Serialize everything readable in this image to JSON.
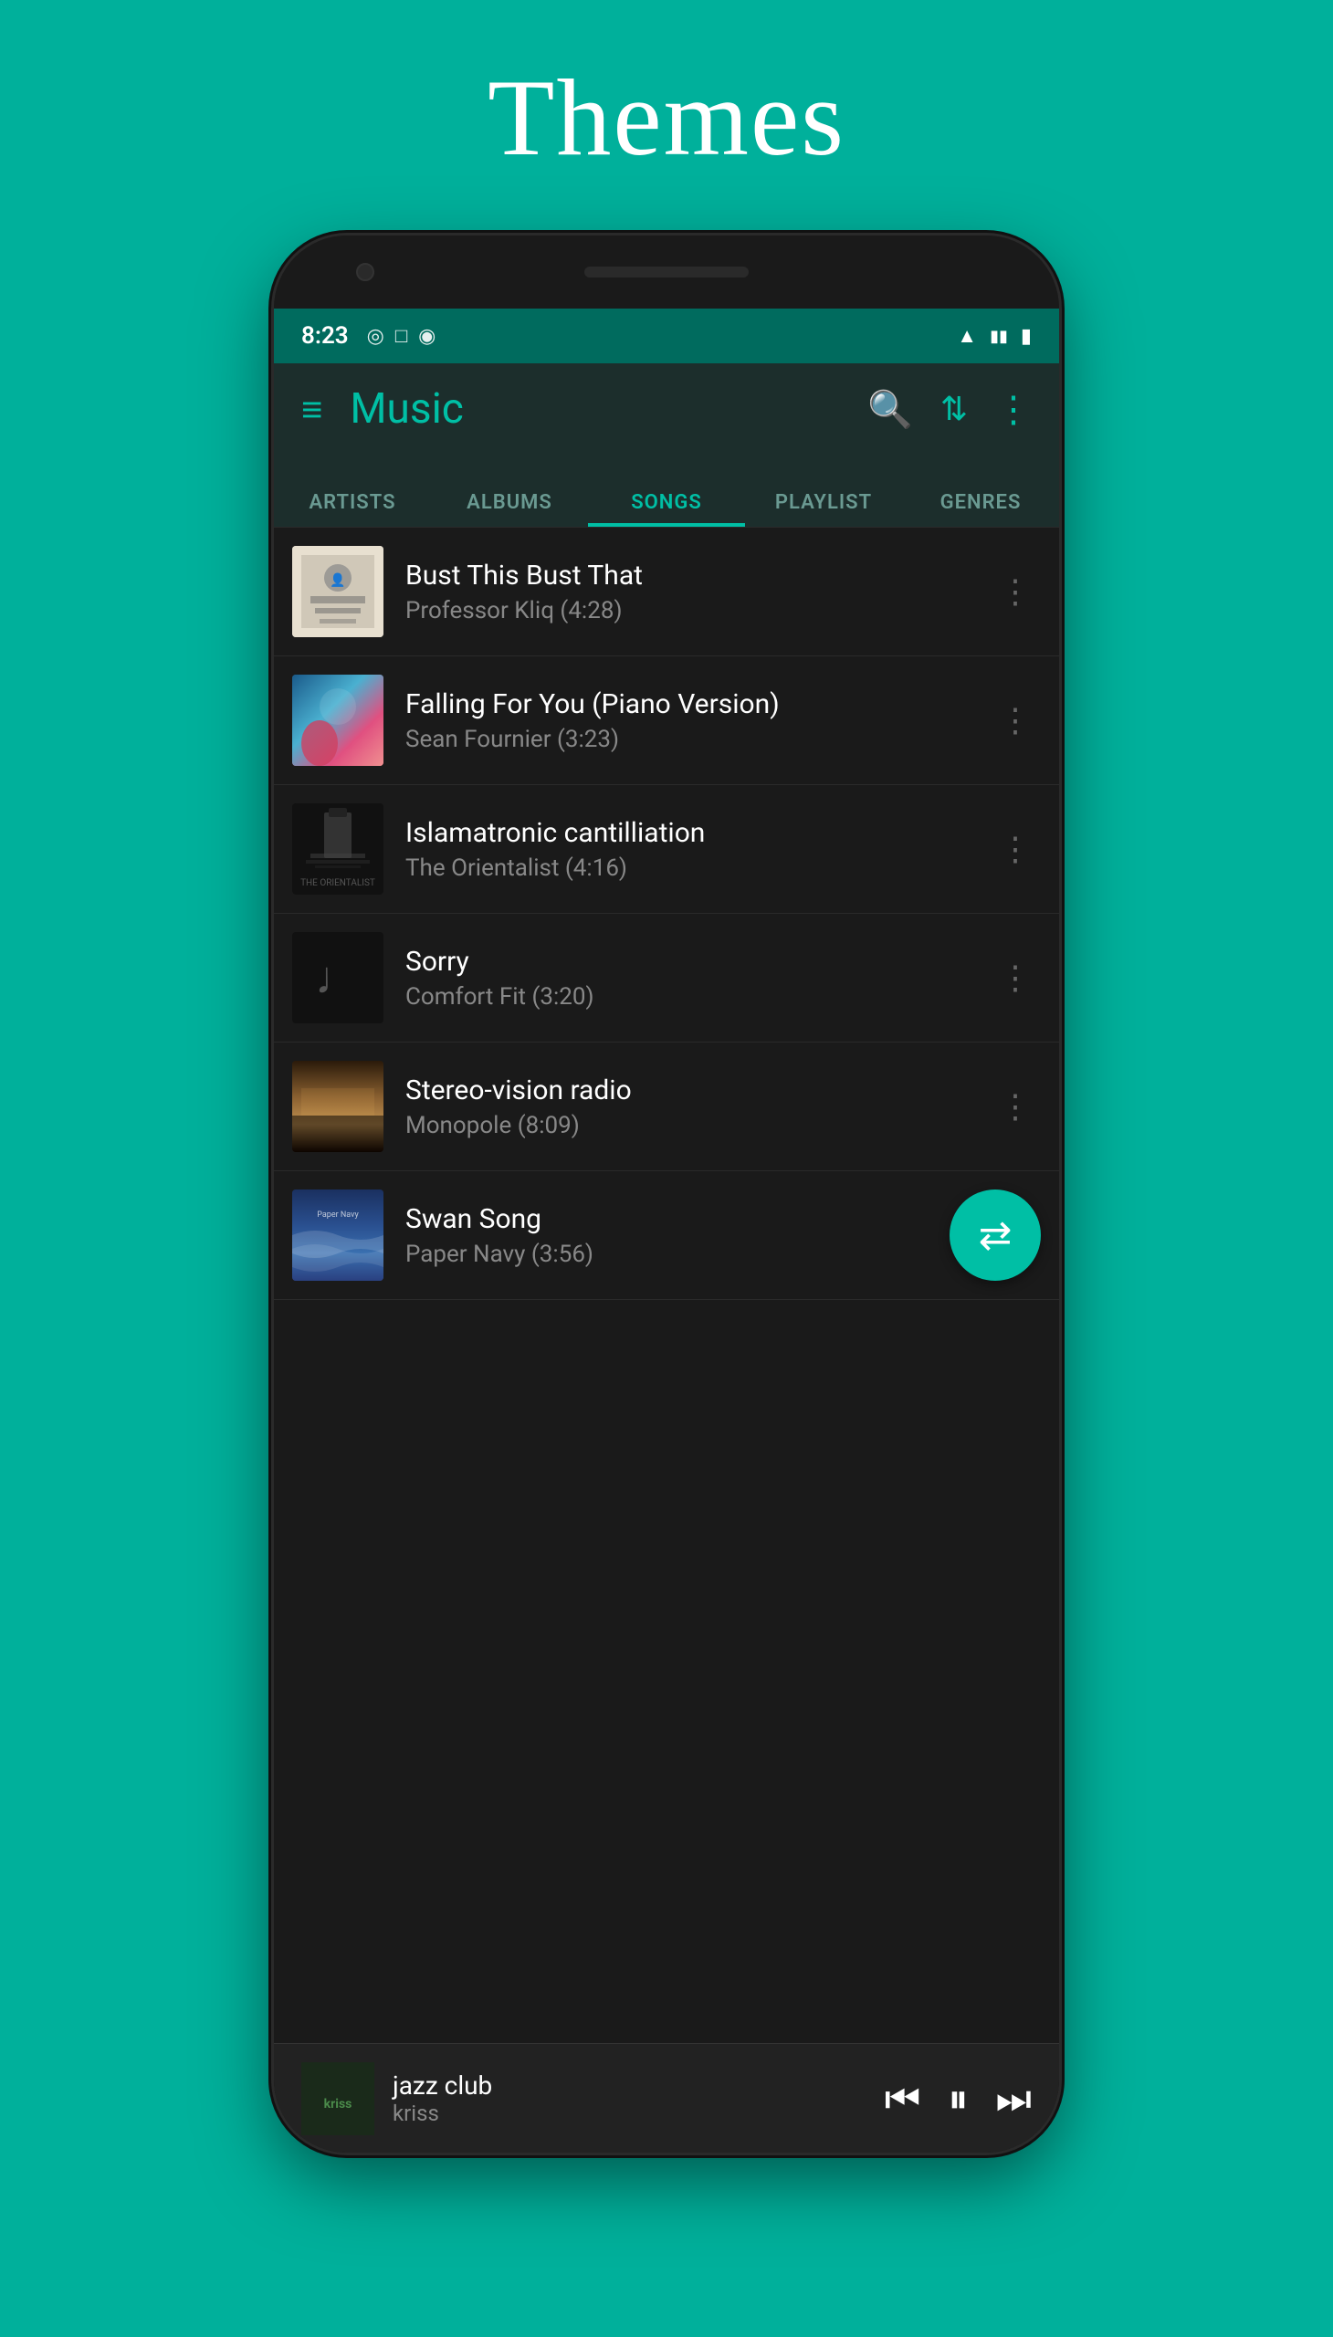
{
  "page": {
    "title": "Themes",
    "background_color": "#00B09B"
  },
  "status_bar": {
    "time": "8:23",
    "icons": [
      "●",
      "□",
      "◎"
    ],
    "right_icons": [
      "wifi",
      "signal",
      "battery"
    ]
  },
  "toolbar": {
    "title": "Music",
    "menu_icon": "≡",
    "search_icon": "🔍",
    "sort_icon": "⇅",
    "more_icon": "⋮"
  },
  "tabs": [
    {
      "label": "ARTISTS",
      "active": false
    },
    {
      "label": "ALBUMS",
      "active": false
    },
    {
      "label": "SONGS",
      "active": true
    },
    {
      "label": "PLAYLIST",
      "active": false
    },
    {
      "label": "GENRES",
      "active": false
    }
  ],
  "songs": [
    {
      "title": "Bust This Bust That",
      "subtitle": "Professor Kliq (4:28)",
      "art_type": "community-service"
    },
    {
      "title": "Falling For You (Piano Version)",
      "subtitle": "Sean Fournier (3:23)",
      "art_type": "sean"
    },
    {
      "title": "Islamatronic cantilliation",
      "subtitle": "The Orientalist (4:16)",
      "art_type": "orientalist"
    },
    {
      "title": "Sorry",
      "subtitle": "Comfort Fit (3:20)",
      "art_type": "comfort"
    },
    {
      "title": "Stereo-vision radio",
      "subtitle": "Monopole (8:09)",
      "art_type": "monopole"
    },
    {
      "title": "Swan Song",
      "subtitle": "Paper Navy (3:56)",
      "art_type": "paper-navy"
    }
  ],
  "now_playing": {
    "title": "jazz club",
    "artist": "kriss",
    "art_type": "kriss"
  },
  "fab": {
    "icon": "⇄",
    "label": "Shuffle"
  }
}
